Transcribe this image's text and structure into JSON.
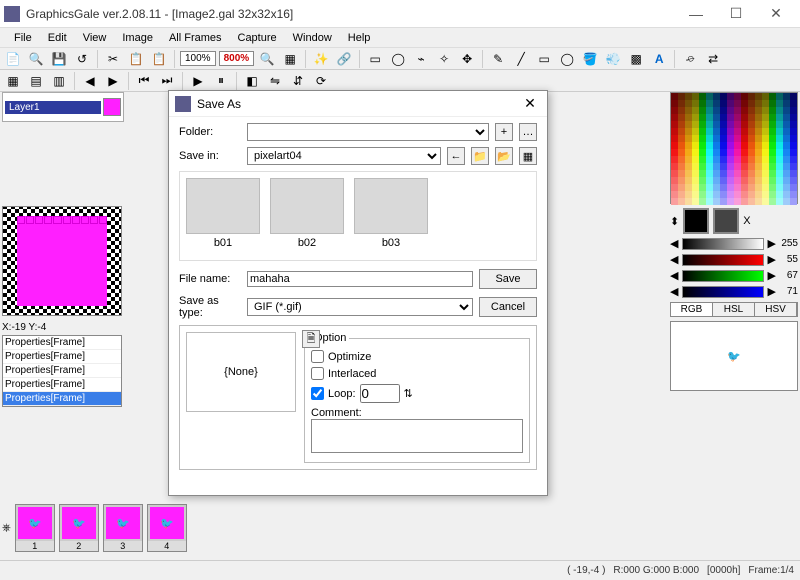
{
  "window": {
    "title": "GraphicsGale ver.2.08.11 - [Image2.gal 32x32x16]",
    "controls": {
      "min": "—",
      "max": "☐",
      "close": "✕"
    }
  },
  "menu": [
    "File",
    "Edit",
    "View",
    "Image",
    "All Frames",
    "Capture",
    "Window",
    "Help"
  ],
  "toolbar": {
    "zoom_to_fit": "100%",
    "zoom": "800%"
  },
  "left": {
    "layer_label": "Layer1",
    "coord": "X:-19 Y:-4",
    "props": [
      "Properties[Frame]",
      "Properties[Frame]",
      "Properties[Frame]",
      "Properties[Frame]",
      "Properties[Frame]"
    ]
  },
  "right": {
    "slider_v": "255",
    "slider_r": "55",
    "slider_g": "67",
    "slider_b": "71",
    "tabs": [
      "RGB",
      "HSL",
      "HSV"
    ]
  },
  "frames": [
    "1",
    "2",
    "3",
    "4"
  ],
  "status": {
    "coord": "( -19,-4 )",
    "rgb": "R:000 G:000 B:000",
    "hex": "[0000h]",
    "frame": "Frame:1/4"
  },
  "dialog": {
    "title": "Save As",
    "folder_label": "Folder:",
    "savein_label": "Save in:",
    "savein_value": "pixelart04",
    "files": [
      "b01",
      "b02",
      "b03"
    ],
    "filename_label": "File name:",
    "filename_value": "mahaha",
    "filetype_label": "Save as type:",
    "filetype_value": "GIF (*.gif)",
    "save_btn": "Save",
    "cancel_btn": "Cancel",
    "option_legend": "Option",
    "none_label": "{None}",
    "optimize_label": "Optimize",
    "interlaced_label": "Interlaced",
    "loop_label": "Loop:",
    "loop_value": "0",
    "comment_label": "Comment:"
  }
}
